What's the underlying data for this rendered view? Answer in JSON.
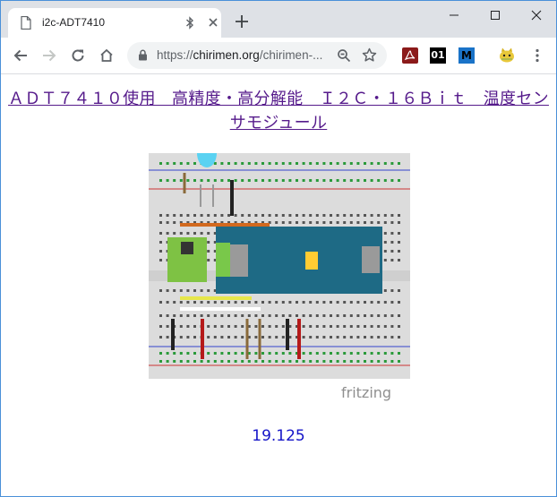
{
  "browser": {
    "tab": {
      "title": "i2c-ADT7410"
    },
    "address": {
      "scheme": "https://",
      "host": "chirimen.org",
      "path": "/chirimen-..."
    }
  },
  "page": {
    "heading": "ＡＤＴ７４１０使用　高精度・高分解能　Ｉ２Ｃ・１６Ｂｉｔ　温度センサモジュール",
    "diagram": {
      "watermark": "fritzing"
    },
    "temperature": "19.125"
  },
  "extensions": [
    {
      "name": "pdf-extension-icon",
      "color": "#8b1a1a"
    },
    {
      "name": "01-extension-icon",
      "label": "01",
      "color": "#000000"
    },
    {
      "name": "m-extension-icon",
      "label": "M",
      "color": "#1a73c8"
    },
    {
      "name": "cat-extension-icon",
      "color": "#d7b21e"
    }
  ]
}
